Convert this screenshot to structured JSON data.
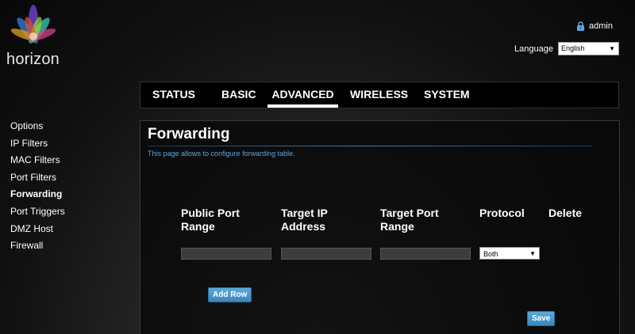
{
  "brand": {
    "logo_text": "horizon"
  },
  "user": {
    "name": "admin",
    "icon": "lock-icon"
  },
  "language": {
    "label": "Language",
    "selected": "English"
  },
  "nav": {
    "tabs": [
      {
        "label": "STATUS"
      },
      {
        "label": "BASIC"
      },
      {
        "label": "ADVANCED"
      },
      {
        "label": "WIRELESS"
      },
      {
        "label": "SYSTEM"
      }
    ],
    "active": "ADVANCED"
  },
  "sidebar": {
    "items": [
      {
        "label": "Options"
      },
      {
        "label": "IP Filters"
      },
      {
        "label": "MAC Filters"
      },
      {
        "label": "Port Filters"
      },
      {
        "label": "Forwarding"
      },
      {
        "label": "Port Triggers"
      },
      {
        "label": "DMZ Host"
      },
      {
        "label": "Firewall"
      }
    ],
    "active": "Forwarding"
  },
  "panel": {
    "title": "Forwarding",
    "description": "This page allows to configure forwarding table.",
    "columns": [
      {
        "label": "Public Port Range"
      },
      {
        "label": "Target IP Address"
      },
      {
        "label": "Target Port Range"
      },
      {
        "label": "Protocol"
      },
      {
        "label": "Delete"
      }
    ],
    "row": {
      "public_port_range": "",
      "target_ip": "",
      "target_port_range": "",
      "protocol": "Both"
    },
    "add_row_label": "Add Row",
    "save_label": "Save"
  },
  "colors": {
    "accent": "#3a86bd",
    "description_text": "#5fa4d9"
  }
}
